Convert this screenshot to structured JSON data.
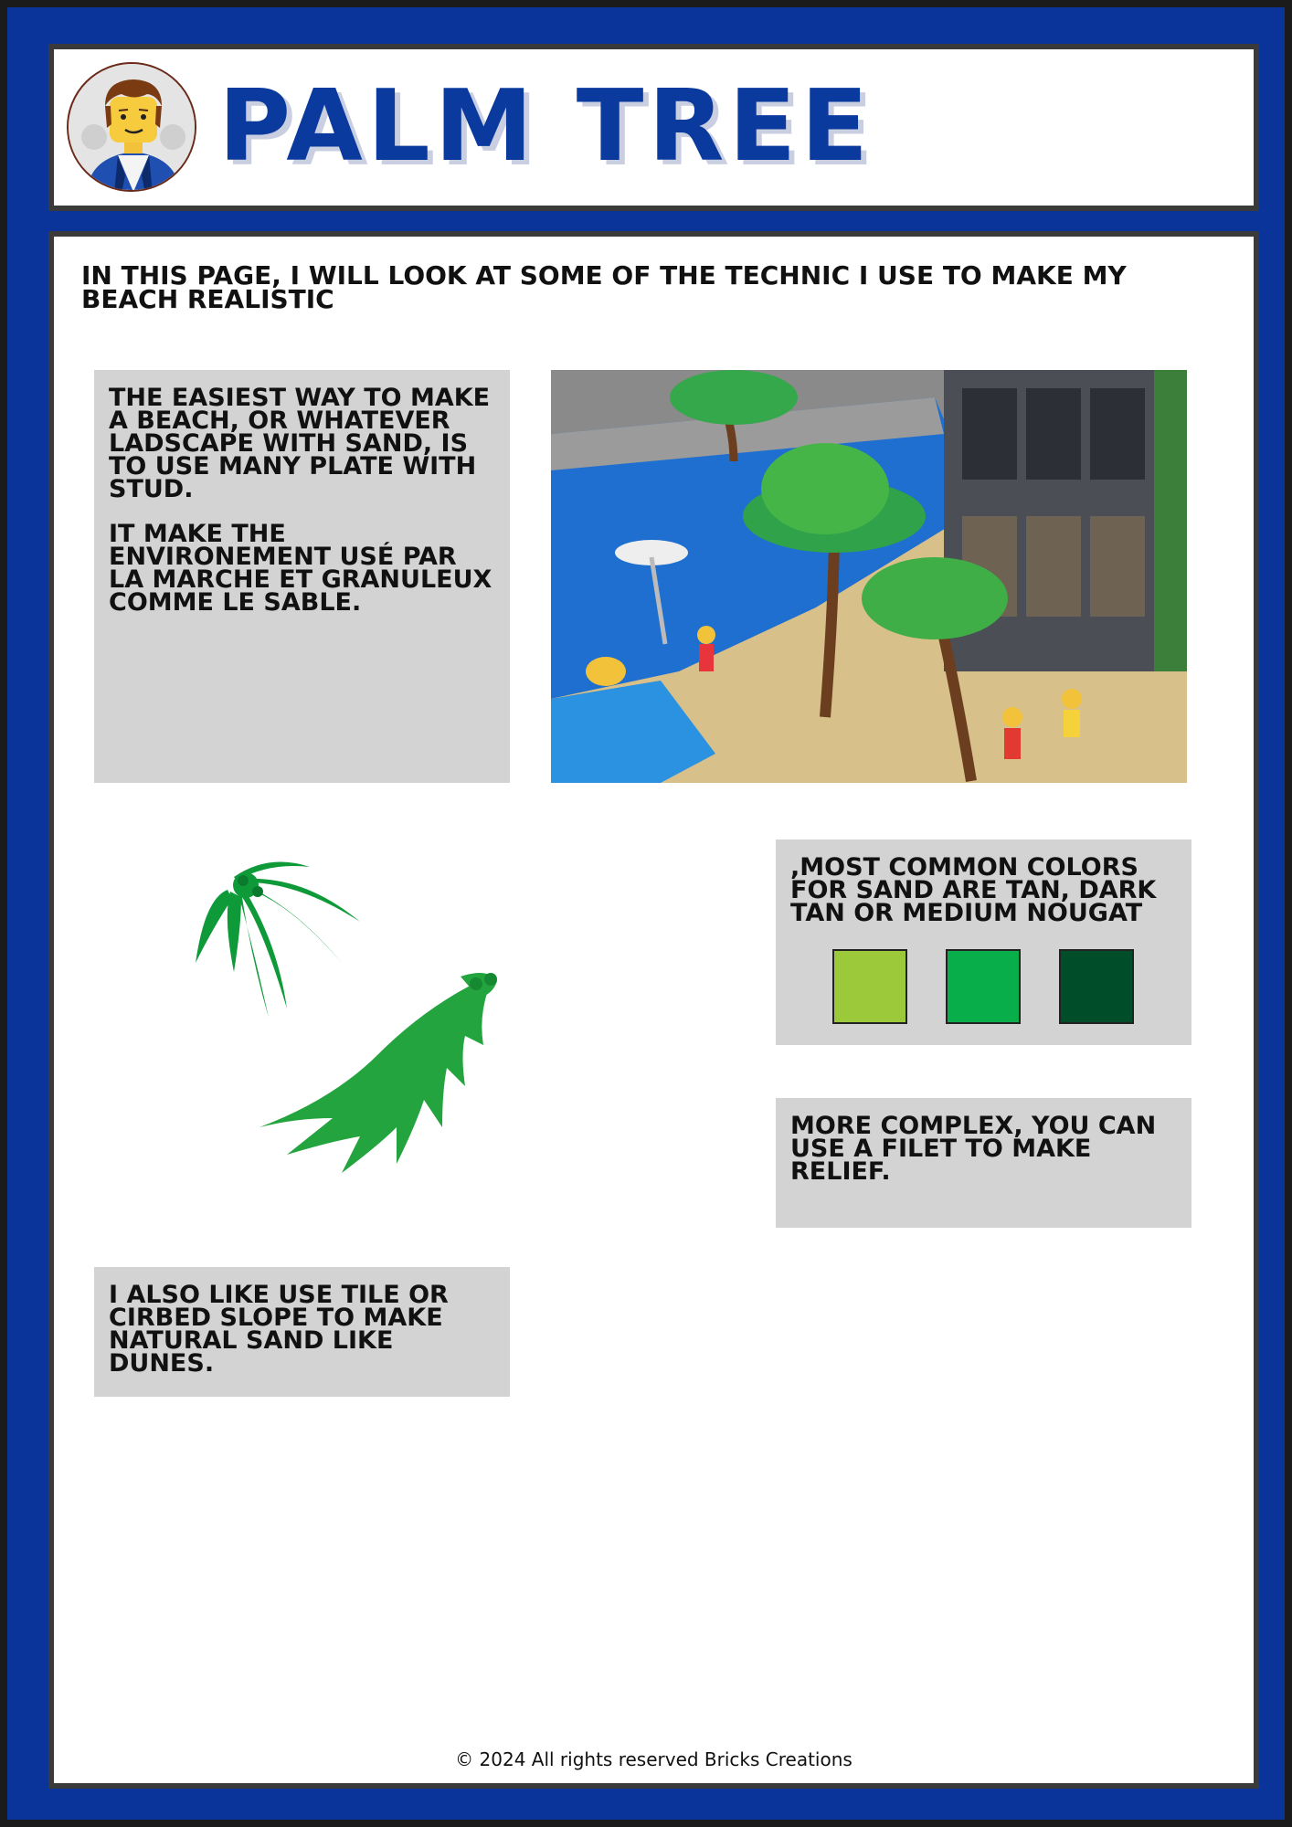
{
  "header": {
    "title": "PALM TREE",
    "avatar_icon": "lego-minifigure-avatar-icon"
  },
  "intro": "IN THIS PAGE, I WILL LOOK AT SOME OF THE TECHNIC I USE TO MAKE MY BEACH REALISTIC",
  "cards": {
    "sand_plates": {
      "p1": "THE EASIEST WAY TO MAKE A BEACH, OR WHATEVER LADSCAPE WITH SAND, IS TO USE MANY PLATE WITH STUD.",
      "p2": "IT MAKE THE ENVIRONEMENT USÉ PAR LA MARCHE ET GRANULEUX COMME LE SABLE."
    },
    "colors": {
      "text": ",MOST COMMON COLORS FOR SAND ARE TAN, DARK TAN OR MEDIUM NOUGAT",
      "swatches": [
        "#9cc93a",
        "#08ae49",
        "#004d2a"
      ]
    },
    "relief": "MORE COMPLEX, YOU CAN USE A FILET TO MAKE RELIEF.",
    "dunes": "I ALSO LIKE USE TILE OR CIRBED SLOPE TO MAKE NATURAL SAND LIKE DUNES."
  },
  "images": {
    "beach_photo": "lego-beach-scene-image",
    "palm_leaves": "lego-palm-leaf-pieces-image"
  },
  "footer": "© 2024 All rights reserved Bricks Creations"
}
